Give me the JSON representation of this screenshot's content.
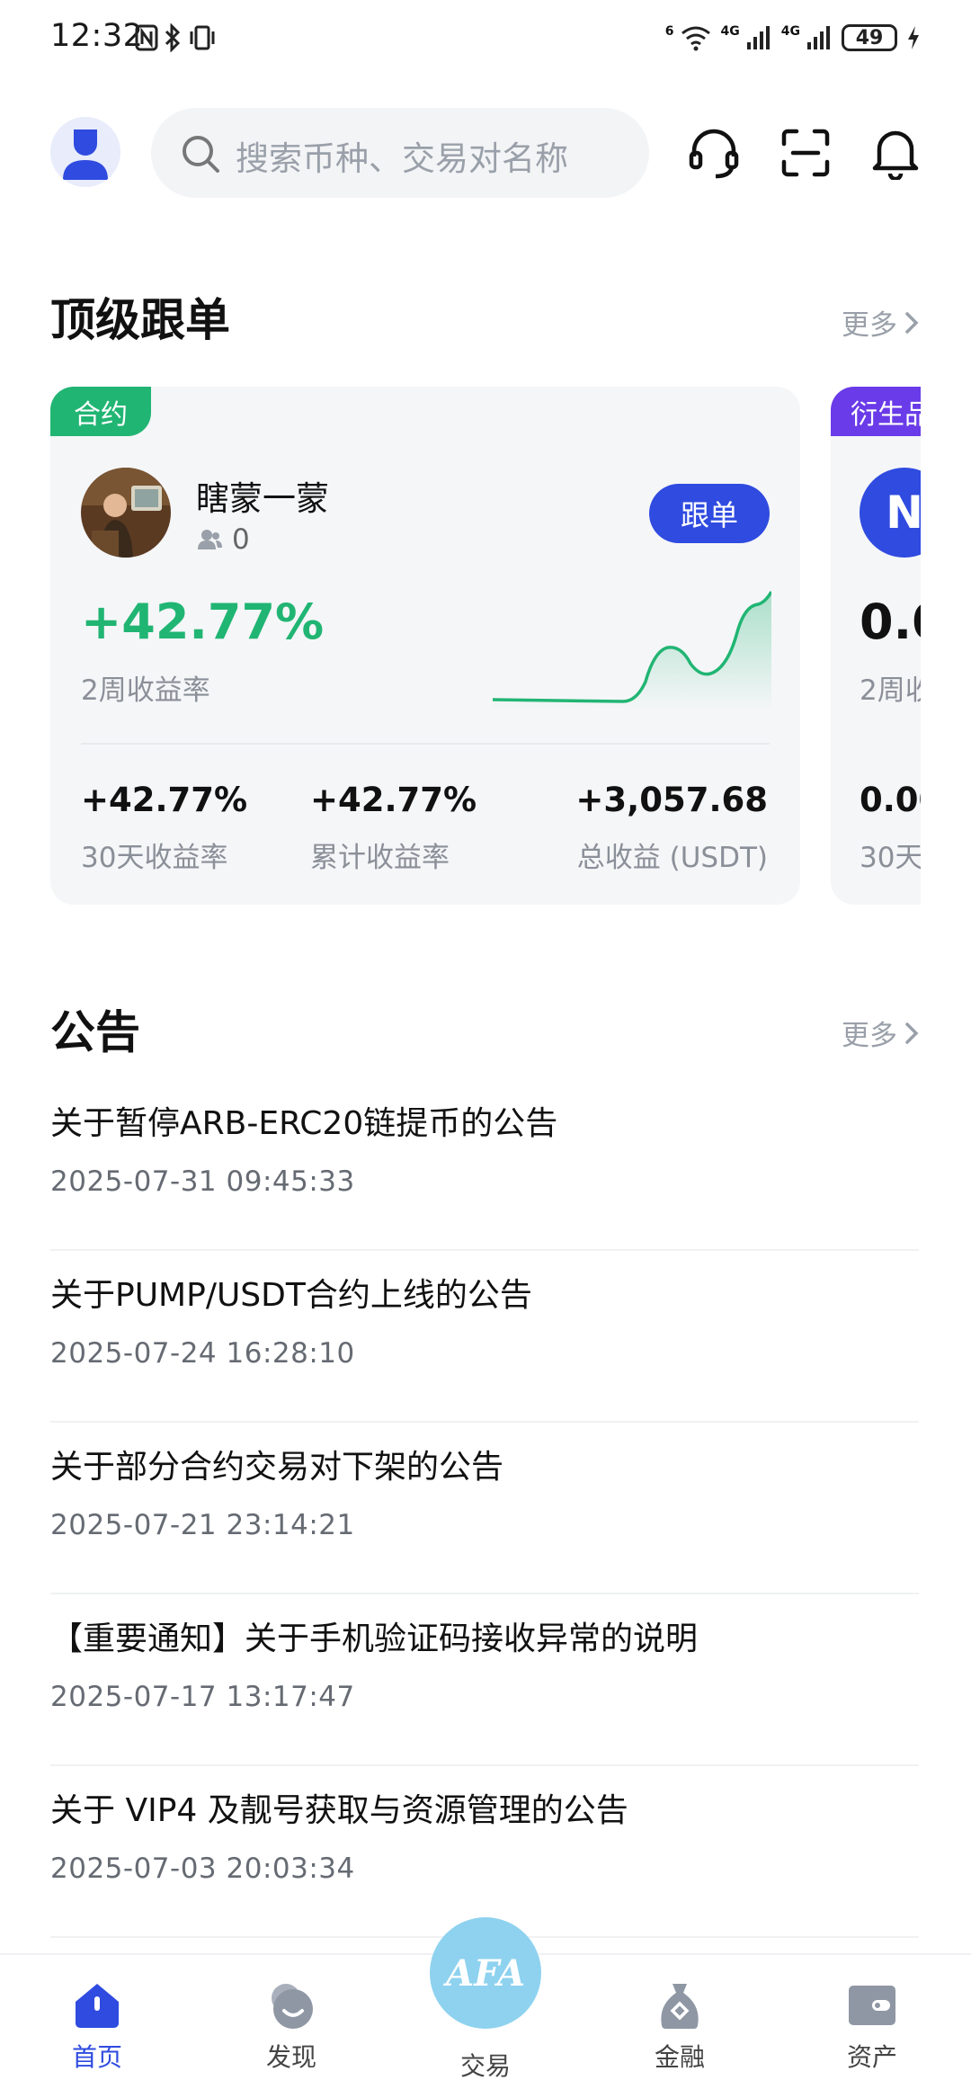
{
  "status_bar": {
    "time": "12:32",
    "network_labels": [
      "6",
      "4G",
      "4G"
    ],
    "battery": "49"
  },
  "header": {
    "search_placeholder": "搜索币种、交易对名称"
  },
  "top_copy_trading": {
    "title": "顶级跟单",
    "more_label": "更多",
    "card": {
      "tag": "合约",
      "trader_name": "瞎蒙一蒙",
      "followers": "0",
      "follow_button": "跟单",
      "main_return": "+42.77%",
      "main_return_label": "2周收益率",
      "stats": [
        {
          "value": "+42.77%",
          "label": "30天收益率"
        },
        {
          "value": "+42.77%",
          "label": "累计收益率"
        },
        {
          "value": "+3,057.68",
          "label": "总收益 (USDT)"
        }
      ]
    },
    "peek_card": {
      "tag": "衍生品",
      "avatar_letter": "N",
      "main_return": "0.0",
      "main_return_label": "2周收",
      "stat_value": "0.00",
      "stat_label": "30天"
    }
  },
  "announcements": {
    "title": "公告",
    "more_label": "更多",
    "items": [
      {
        "title": "关于暂停ARB-ERC20链提币的公告",
        "date": "2025-07-31 09:45:33"
      },
      {
        "title": "关于PUMP/USDT合约上线的公告",
        "date": "2025-07-24 16:28:10"
      },
      {
        "title": "关于部分合约交易对下架的公告",
        "date": "2025-07-21 23:14:21"
      },
      {
        "title": "【重要通知】关于手机验证码接收异常的说明",
        "date": "2025-07-17 13:17:47"
      },
      {
        "title": "关于 VIP4 及靓号获取与资源管理的公告",
        "date": "2025-07-03 20:03:34"
      }
    ]
  },
  "bottom_nav": {
    "items": [
      {
        "label": "首页",
        "icon": "home-icon",
        "active": true
      },
      {
        "label": "发现",
        "icon": "discover-icon"
      },
      {
        "label": "交易",
        "icon": "trade-logo-icon",
        "logo_text": "AFA"
      },
      {
        "label": "金融",
        "icon": "finance-bag-icon"
      },
      {
        "label": "资产",
        "icon": "wallet-icon"
      }
    ]
  },
  "colors": {
    "accent": "#2f4be0",
    "positive": "#21b573",
    "derivatives_tag": "#6a3be8"
  }
}
